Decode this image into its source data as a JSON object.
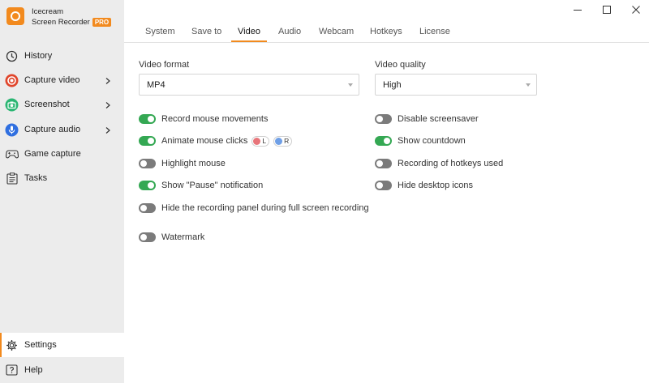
{
  "app": {
    "name_line1": "Icecream",
    "name_line2": "Screen Recorder",
    "badge": "PRO",
    "accent": "#f28a1e"
  },
  "sidebar": {
    "items": [
      {
        "label": "History"
      },
      {
        "label": "Capture video"
      },
      {
        "label": "Screenshot"
      },
      {
        "label": "Capture audio"
      },
      {
        "label": "Game capture"
      },
      {
        "label": "Tasks"
      },
      {
        "label": "Settings"
      },
      {
        "label": "Help"
      }
    ]
  },
  "tabs": [
    "System",
    "Save to",
    "Video",
    "Audio",
    "Webcam",
    "Hotkeys",
    "License"
  ],
  "active_tab": "Video",
  "video": {
    "format_label": "Video format",
    "format_value": "MP4",
    "quality_label": "Video quality",
    "quality_value": "High"
  },
  "options_left": [
    {
      "label": "Record mouse movements",
      "on": true
    },
    {
      "label": "Animate mouse clicks",
      "on": true,
      "pill_left": "L",
      "pill_right": "R"
    },
    {
      "label": "Highlight mouse",
      "on": false
    },
    {
      "label": "Show \"Pause\" notification",
      "on": true
    },
    {
      "label": "Hide the recording panel during full screen recording",
      "on": false
    },
    {
      "label": "Watermark",
      "on": false
    }
  ],
  "options_right": [
    {
      "label": "Disable screensaver",
      "on": false
    },
    {
      "label": "Show countdown",
      "on": true
    },
    {
      "label": "Recording of hotkeys used",
      "on": false
    },
    {
      "label": "Hide desktop icons",
      "on": false
    }
  ],
  "colors": {
    "toggle_on": "#34a853",
    "toggle_off": "#7b7b7b",
    "click_left": "#e8757a",
    "click_right": "#6f9fe6"
  }
}
